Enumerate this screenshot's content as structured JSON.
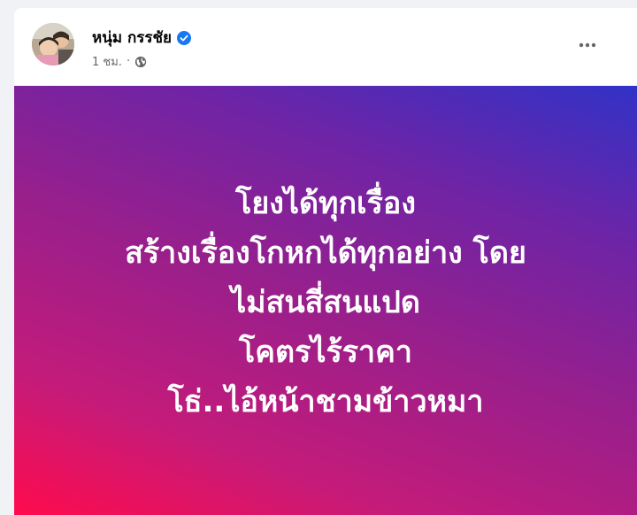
{
  "author": {
    "name": "หนุ่ม กรรชัย",
    "verified": true,
    "verified_color": "#1877f2"
  },
  "post": {
    "time": "1 ชม.",
    "separator": "·",
    "audience_icon": "globe-icon",
    "menu_icon": "more-horizontal-icon",
    "background_gradient": [
      "#ff0b4d",
      "#9a1f8b",
      "#3132c7"
    ],
    "lines": [
      "โยงได้ทุกเรื่อง",
      "สร้างเรื่องโกหกได้ทุกอย่าง โดย",
      "ไม่สนสี่สนแปด",
      "โคตรไร้ราคา",
      "โธ่..ไอ้หน้าชามข้าวหมา"
    ]
  }
}
